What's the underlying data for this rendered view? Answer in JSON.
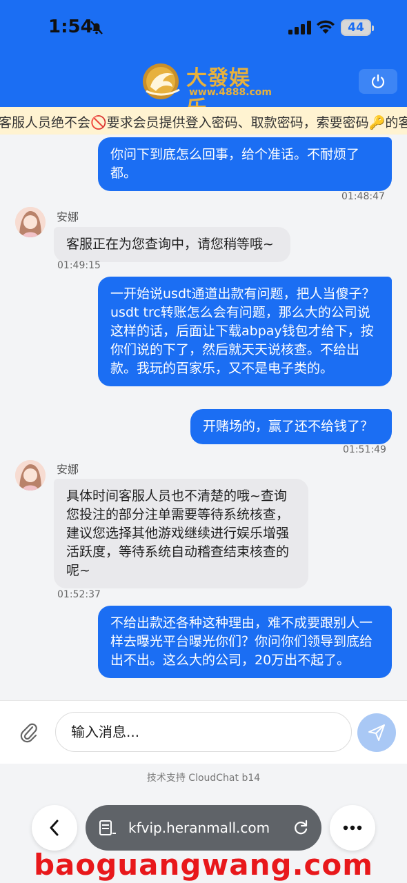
{
  "status_bar": {
    "time": "1:54",
    "battery": "44"
  },
  "brand": {
    "title": "大發娱乐",
    "url": "www.4888.com"
  },
  "notice": "客服人员绝不会🚫要求会员提供登入密码、取款密码，索要密码🔑的客服都",
  "messages": [
    {
      "side": "out",
      "text": "你问下到底怎么回事，给个准话。不耐烦了都。",
      "time": "01:48:47"
    },
    {
      "side": "in",
      "name": "安娜",
      "text": "客服正在为您查询中，请您稍等哦~",
      "time": "01:49:15"
    },
    {
      "side": "out",
      "text": "一开始说usdt通道出款有问题，把人当傻子？usdt trc转账怎么会有问题，那么大的公司说这样的话，后面让下载abpay钱包才给下，按你们说的下了，然后就天天说核查。不给出款。我玩的百家乐，又不是电子类的。"
    },
    {
      "side": "out",
      "text": "开赌场的，赢了还不给钱了？",
      "time": "01:51:49"
    },
    {
      "side": "in",
      "name": "安娜",
      "text": "具体时间客服人员也不清楚的哦~查询您投注的部分注单需要等待系统核查，建议您选择其他游戏继续进行娱乐增强活跃度，等待系统自动稽查结束核查的呢~",
      "time": "01:52:37"
    },
    {
      "side": "out",
      "text": "不给出款还各种这种理由，难不成要跟别人一样去曝光平台曝光你们？你问你们领导到底给出不出。这么大的公司，20万出不起了。"
    }
  ],
  "input": {
    "placeholder": "输入消息..."
  },
  "footer": {
    "powered_by": "技术支持 CloudChat b14"
  },
  "browser": {
    "url": "kfvip.heranmall.com"
  },
  "watermark": "baoguangwang.com",
  "colors": {
    "primary": "#1b6ef3",
    "incoming_bubble": "#e9e9ec",
    "notice_bg": "#fff3d1",
    "brand_gold": "#e7b13d"
  }
}
